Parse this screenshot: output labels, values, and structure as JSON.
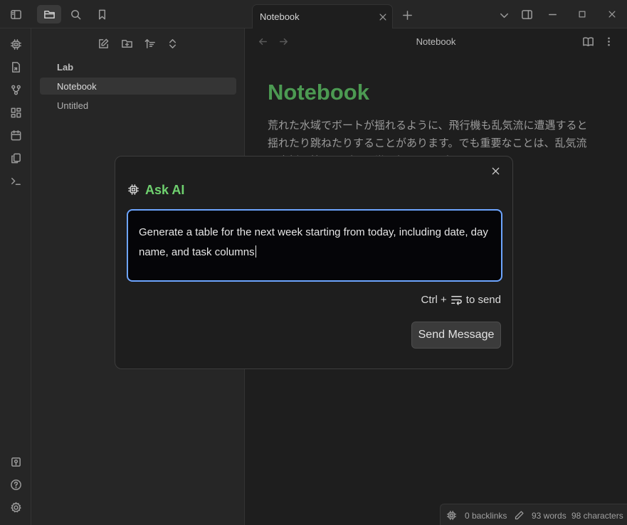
{
  "app": {
    "accent": "#6da5ff",
    "title_green": "#4c9a52"
  },
  "sidebar": {
    "folder": "Lab",
    "files": [
      {
        "label": "Notebook",
        "active": true
      },
      {
        "label": "Untitled",
        "active": false
      }
    ]
  },
  "tabs": [
    {
      "label": "Notebook"
    }
  ],
  "editor": {
    "view_title": "Notebook",
    "note_title": "Notebook",
    "body_text": "荒れた水域でボートが揺れるように、飛行機も乱気流に遭遇すると揺れたり跳ねたりすることがあります。でも重要なことは、乱気流は大抵不快ですが、通常は何か問題があ"
  },
  "modal": {
    "title": "Ask AI",
    "input_value": "Generate a table for the next week starting from today, including date, day name, and task columns",
    "send_hint_prefix": "Ctrl +",
    "send_hint_suffix": "to send",
    "send_button": "Send Message"
  },
  "status": {
    "backlinks": "0 backlinks",
    "words": "93 words",
    "characters": "98 characters"
  }
}
